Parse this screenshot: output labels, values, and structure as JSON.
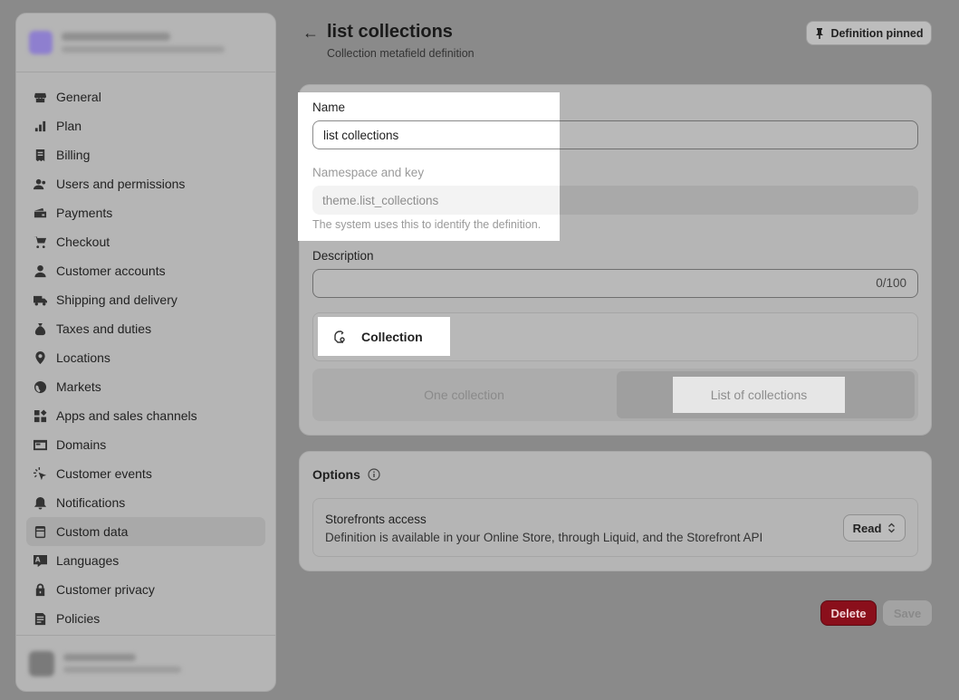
{
  "sidebar": {
    "items": [
      {
        "label": "General",
        "icon": "store-icon"
      },
      {
        "label": "Plan",
        "icon": "plan-icon"
      },
      {
        "label": "Billing",
        "icon": "billing-icon"
      },
      {
        "label": "Users and permissions",
        "icon": "users-icon"
      },
      {
        "label": "Payments",
        "icon": "payments-icon"
      },
      {
        "label": "Checkout",
        "icon": "cart-icon"
      },
      {
        "label": "Customer accounts",
        "icon": "person-icon"
      },
      {
        "label": "Shipping and delivery",
        "icon": "truck-icon"
      },
      {
        "label": "Taxes and duties",
        "icon": "money-bag-icon"
      },
      {
        "label": "Locations",
        "icon": "location-pin-icon"
      },
      {
        "label": "Markets",
        "icon": "globe-icon"
      },
      {
        "label": "Apps and sales channels",
        "icon": "apps-icon"
      },
      {
        "label": "Domains",
        "icon": "domains-icon"
      },
      {
        "label": "Customer events",
        "icon": "cursor-click-icon"
      },
      {
        "label": "Notifications",
        "icon": "bell-icon"
      },
      {
        "label": "Custom data",
        "icon": "database-icon",
        "active": true
      },
      {
        "label": "Languages",
        "icon": "language-icon"
      },
      {
        "label": "Customer privacy",
        "icon": "lock-icon"
      },
      {
        "label": "Policies",
        "icon": "policy-icon"
      }
    ]
  },
  "header": {
    "title": "list collections",
    "subtitle": "Collection metafield definition",
    "pin_label": "Definition pinned"
  },
  "form": {
    "name_label": "Name",
    "name_value": "list collections",
    "namespace_label": "Namespace and key",
    "namespace_value": "theme.list_collections",
    "namespace_help": "The system uses this to identify the definition.",
    "description_label": "Description",
    "description_counter": "0/100",
    "type_label": "Collection",
    "segment_one": "One collection",
    "segment_list": "List of collections"
  },
  "options": {
    "title": "Options",
    "access_title": "Storefronts access",
    "access_desc": "Definition is available in your Online Store, through Liquid, and the Storefront API",
    "access_value": "Read"
  },
  "actions": {
    "delete_label": "Delete",
    "save_label": "Save"
  }
}
